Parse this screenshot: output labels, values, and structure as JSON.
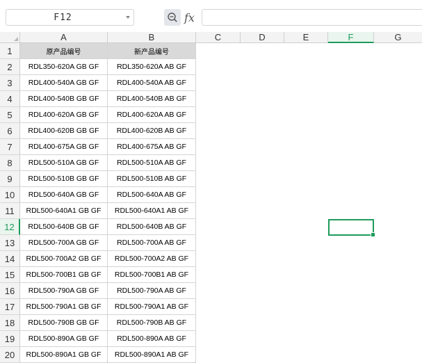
{
  "formula_bar": {
    "name_box": "F12",
    "fx_label": "fx",
    "formula": ""
  },
  "columns": [
    "A",
    "B",
    "C",
    "D",
    "E",
    "F",
    "G"
  ],
  "active_column": "F",
  "active_row": "12",
  "rows": [
    {
      "num": "1",
      "a": "原产品编号",
      "b": "新产品编号"
    },
    {
      "num": "2",
      "a": "RDL350-620A GB GF",
      "b": "RDL350-620A AB GF"
    },
    {
      "num": "3",
      "a": "RDL400-540A GB GF",
      "b": "RDL400-540A AB GF"
    },
    {
      "num": "4",
      "a": "RDL400-540B GB GF",
      "b": "RDL400-540B AB GF"
    },
    {
      "num": "5",
      "a": "RDL400-620A GB GF",
      "b": "RDL400-620A AB GF"
    },
    {
      "num": "6",
      "a": "RDL400-620B GB GF",
      "b": "RDL400-620B AB GF"
    },
    {
      "num": "7",
      "a": "RDL400-675A GB GF",
      "b": "RDL400-675A AB GF"
    },
    {
      "num": "8",
      "a": "RDL500-510A GB GF",
      "b": "RDL500-510A AB GF"
    },
    {
      "num": "9",
      "a": "RDL500-510B GB GF",
      "b": "RDL500-510B AB GF"
    },
    {
      "num": "10",
      "a": "RDL500-640A GB GF",
      "b": "RDL500-640A AB GF"
    },
    {
      "num": "11",
      "a": "RDL500-640A1 GB GF",
      "b": "RDL500-640A1 AB GF"
    },
    {
      "num": "12",
      "a": "RDL500-640B GB GF",
      "b": "RDL500-640B AB GF"
    },
    {
      "num": "13",
      "a": "RDL500-700A GB GF",
      "b": "RDL500-700A AB GF"
    },
    {
      "num": "14",
      "a": "RDL500-700A2 GB GF",
      "b": "RDL500-700A2 AB GF"
    },
    {
      "num": "15",
      "a": "RDL500-700B1 GB GF",
      "b": "RDL500-700B1 AB GF"
    },
    {
      "num": "16",
      "a": "RDL500-790A GB GF",
      "b": "RDL500-790A AB GF"
    },
    {
      "num": "17",
      "a": "RDL500-790A1 GB GF",
      "b": "RDL500-790A1 AB GF"
    },
    {
      "num": "18",
      "a": "RDL500-790B GB GF",
      "b": "RDL500-790B AB GF"
    },
    {
      "num": "19",
      "a": "RDL500-890A GB GF",
      "b": "RDL500-890A AB GF"
    },
    {
      "num": "20",
      "a": "RDL500-890A1 GB GF",
      "b": "RDL500-890A1 AB GF"
    }
  ],
  "colors": {
    "accent": "#1e9b5b",
    "header_fill": "#d9d9d9",
    "gridline": "#d4d4d4"
  }
}
